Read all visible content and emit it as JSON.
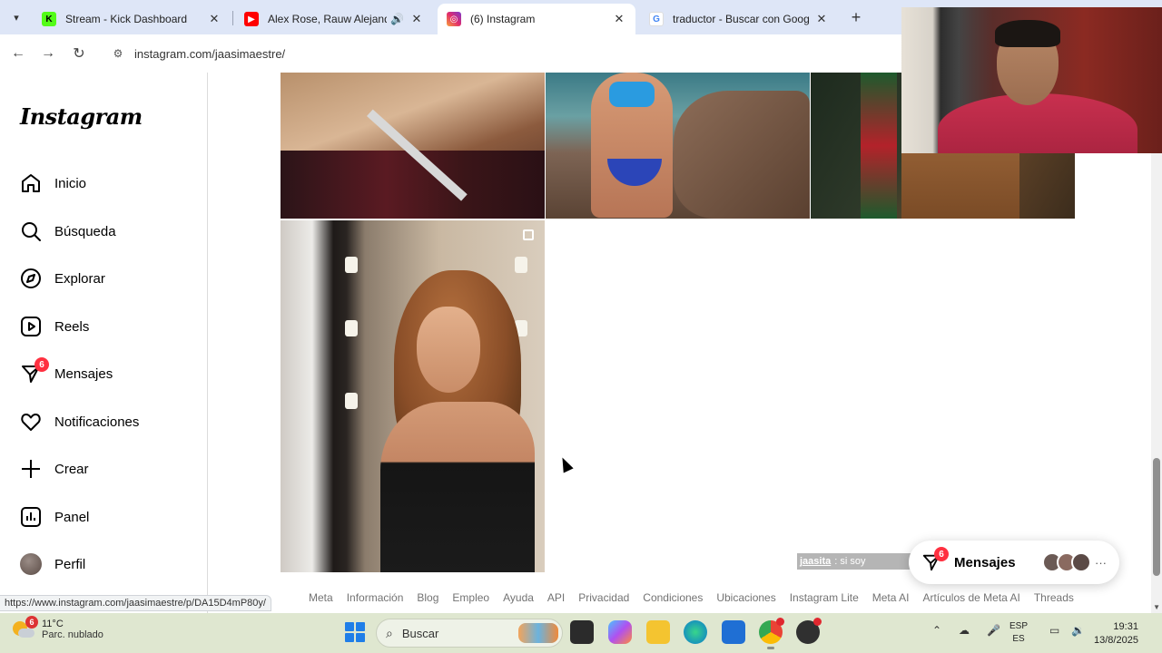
{
  "browser": {
    "tabs": [
      {
        "title": "Stream - Kick Dashboard",
        "favicon": "kick-icon",
        "active": false
      },
      {
        "title": "Alex Rose, Rauw Alejandro",
        "favicon": "youtube-icon",
        "active": false,
        "audio": true
      },
      {
        "title": "(6) Instagram",
        "favicon": "instagram-icon",
        "active": true
      },
      {
        "title": "traductor - Buscar con Google",
        "favicon": "google-icon",
        "active": false
      }
    ],
    "url": "instagram.com/jaasimaestre/"
  },
  "sidebar": {
    "logo": "Instagram",
    "items": [
      {
        "label": "Inicio",
        "icon": "home-icon"
      },
      {
        "label": "Búsqueda",
        "icon": "search-icon"
      },
      {
        "label": "Explorar",
        "icon": "compass-icon"
      },
      {
        "label": "Reels",
        "icon": "reels-icon"
      },
      {
        "label": "Mensajes",
        "icon": "messenger-icon",
        "badge": "6"
      },
      {
        "label": "Notificaciones",
        "icon": "heart-icon"
      },
      {
        "label": "Crear",
        "icon": "plus-icon"
      },
      {
        "label": "Panel",
        "icon": "dashboard-icon"
      },
      {
        "label": "Perfil",
        "icon": "avatar"
      }
    ]
  },
  "footer": {
    "links": [
      "Meta",
      "Información",
      "Blog",
      "Empleo",
      "Ayuda",
      "API",
      "Privacidad",
      "Condiciones",
      "Ubicaciones",
      "Instagram Lite",
      "Meta AI",
      "Artículos de Meta AI",
      "Threads"
    ]
  },
  "status_url": "https://www.instagram.com/jaasimaestre/p/DA15D4mP80y/",
  "messages_float": {
    "label": "Mensajes",
    "badge": "6"
  },
  "chat_overlay": {
    "user": "jaasita",
    "text": ": si soy"
  },
  "taskbar": {
    "weather_temp": "11°C",
    "weather_desc": "Parc. nublado",
    "weather_badge": "6",
    "search_placeholder": "Buscar",
    "lang_line1": "ESP",
    "lang_line2": "ES",
    "time": "19:31",
    "date": "13/8/2025"
  },
  "colors": {
    "badge": "#ff3040",
    "taskbar": "#dfe7d0",
    "tabbar": "#dee6f7"
  }
}
